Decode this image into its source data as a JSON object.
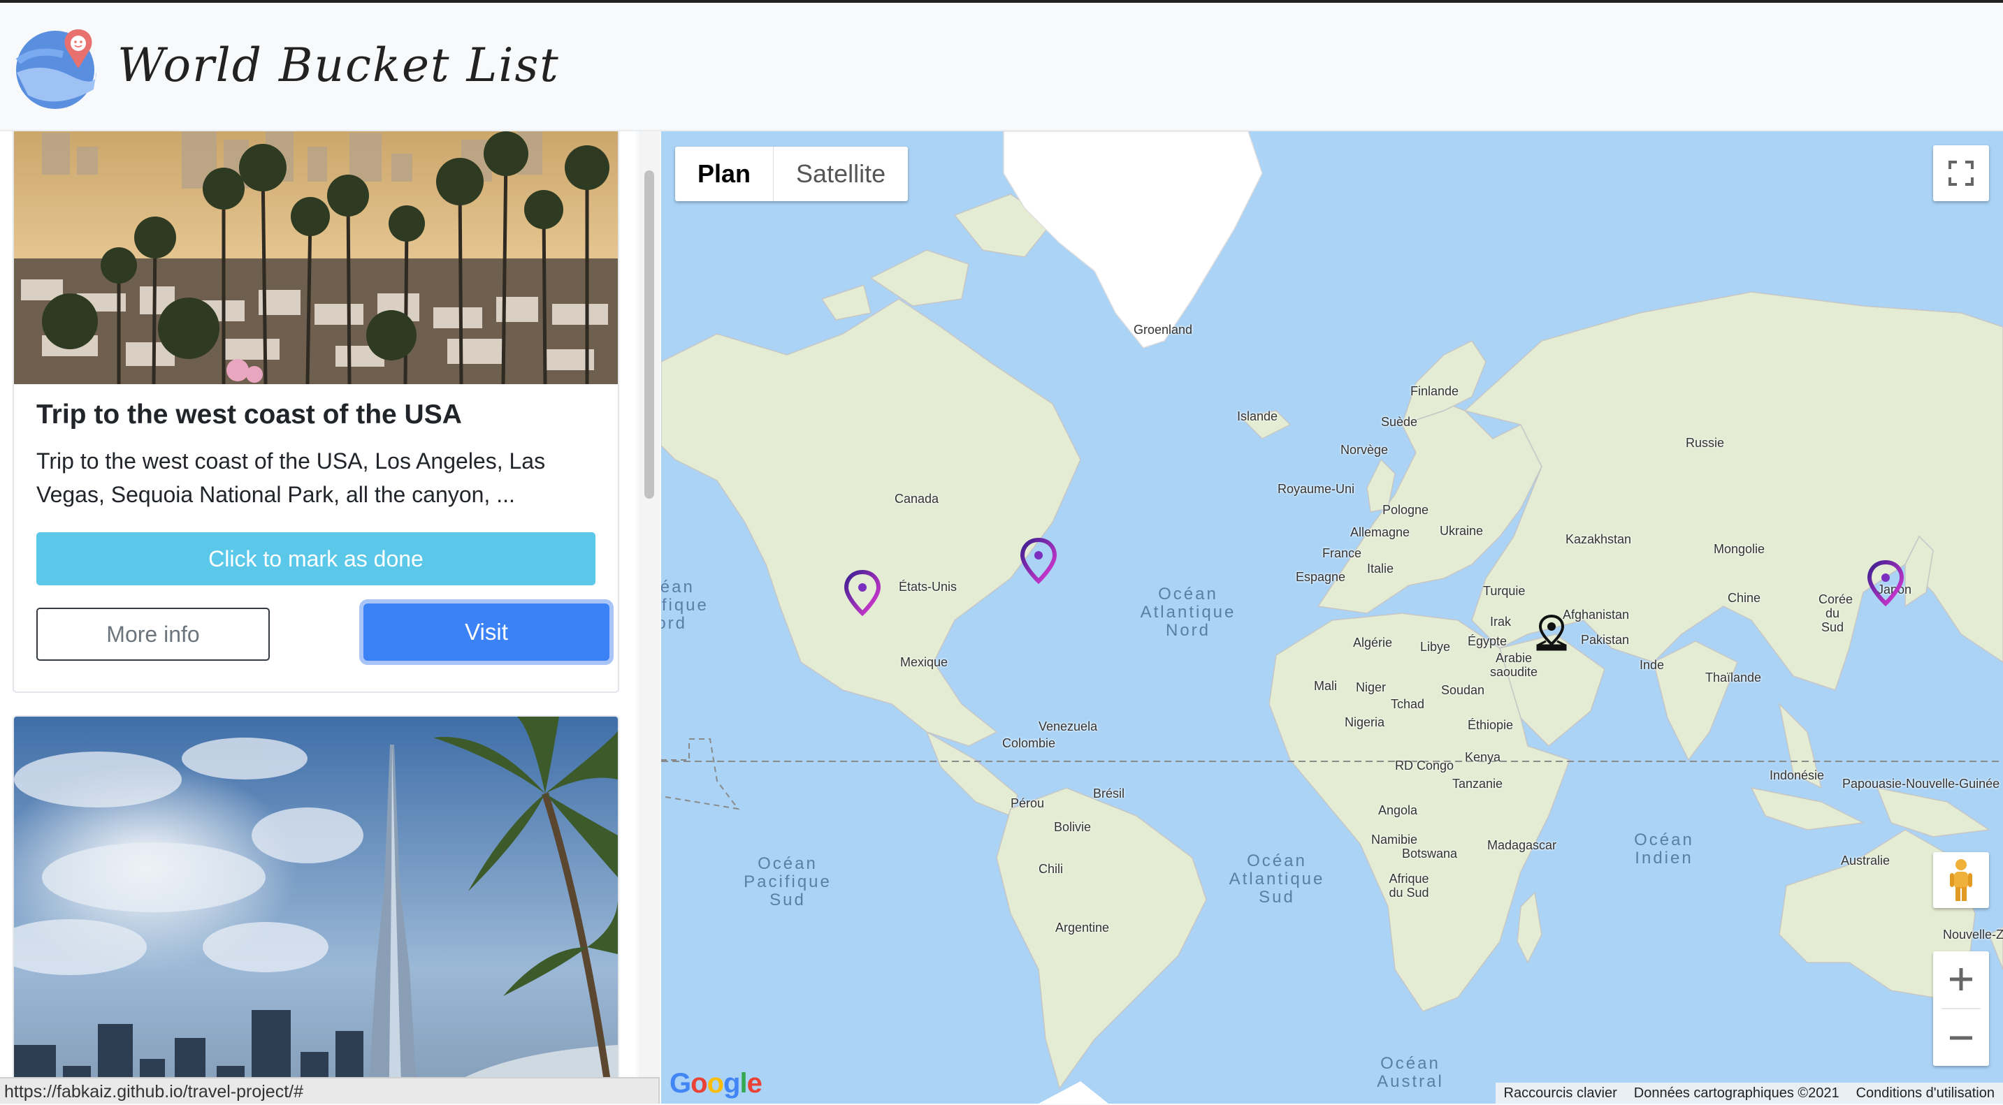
{
  "brand": {
    "title": "World Bucket List"
  },
  "cards": [
    {
      "title": "Trip to the west coast of the USA",
      "description": "Trip to the west coast of the USA, Los Angeles, Las Vegas, Sequoia National Park, all the canyon, ...",
      "mark_done_label": "Click to mark as done",
      "more_info_label": "More info",
      "visit_label": "Visit"
    }
  ],
  "status_bar": {
    "url": "https://fabkaiz.github.io/travel-project/#"
  },
  "map": {
    "type_control": {
      "plan": "Plan",
      "satellite": "Satellite",
      "selected": "Plan"
    },
    "labels": {
      "groenland": "Groenland",
      "islande": "Islande",
      "finlande": "Finlande",
      "suede": "Suède",
      "norvege": "Norvège",
      "russie": "Russie",
      "royaume_uni": "Royaume-Uni",
      "pologne": "Pologne",
      "allemagne": "Allemagne",
      "ukraine": "Ukraine",
      "kazakhstan": "Kazakhstan",
      "mongolie": "Mongolie",
      "france": "France",
      "italie": "Italie",
      "espagne": "Espagne",
      "turquie": "Turquie",
      "chine": "Chine",
      "coree": "Corée du Sud",
      "japon": "Japon",
      "afghanistan": "Afghanistan",
      "pakistan": "Pakistan",
      "irak": "Irak",
      "canada": "Canada",
      "etats_unis": "États-Unis",
      "mexique": "Mexique",
      "algerie": "Algérie",
      "libye": "Libye",
      "egypte": "Égypte",
      "arabie": "Arabie saoudite",
      "inde": "Inde",
      "thailande": "Thaïlande",
      "mali": "Mali",
      "niger": "Niger",
      "tchad": "Tchad",
      "soudan": "Soudan",
      "nigeria": "Nigeria",
      "ethiopie": "Éthiopie",
      "venezuela": "Venezuela",
      "colombie": "Colombie",
      "kenya": "Kenya",
      "rd_congo": "RD Congo",
      "tanzanie": "Tanzanie",
      "indonesie": "Indonésie",
      "papouasie": "Papouasie-Nouvelle-Guinée",
      "perou": "Pérou",
      "bresil": "Brésil",
      "bolivie": "Bolivie",
      "angola": "Angola",
      "namibie": "Namibie",
      "botswana": "Botswana",
      "madagascar": "Madagascar",
      "chili": "Chili",
      "afrique_du_sud": "Afrique du Sud",
      "australie": "Australie",
      "argentine": "Argentine",
      "nouvelle_z": "Nouvelle-Z"
    },
    "oceans": {
      "atlantique_nord": "Océan Atlantique Nord",
      "pacifique_nord_partial": "Océan Pacifique Nord",
      "pacifique_sud": "Océan Pacifique Sud",
      "atlantique_sud": "Océan Atlantique Sud",
      "indien": "Océan Indien",
      "austral": "Océan Austral"
    },
    "attribution": {
      "shortcuts": "Raccourcis clavier",
      "data": "Données cartographiques ©2021",
      "terms": "Conditions d'utilisation"
    },
    "google_logo": "Google"
  }
}
